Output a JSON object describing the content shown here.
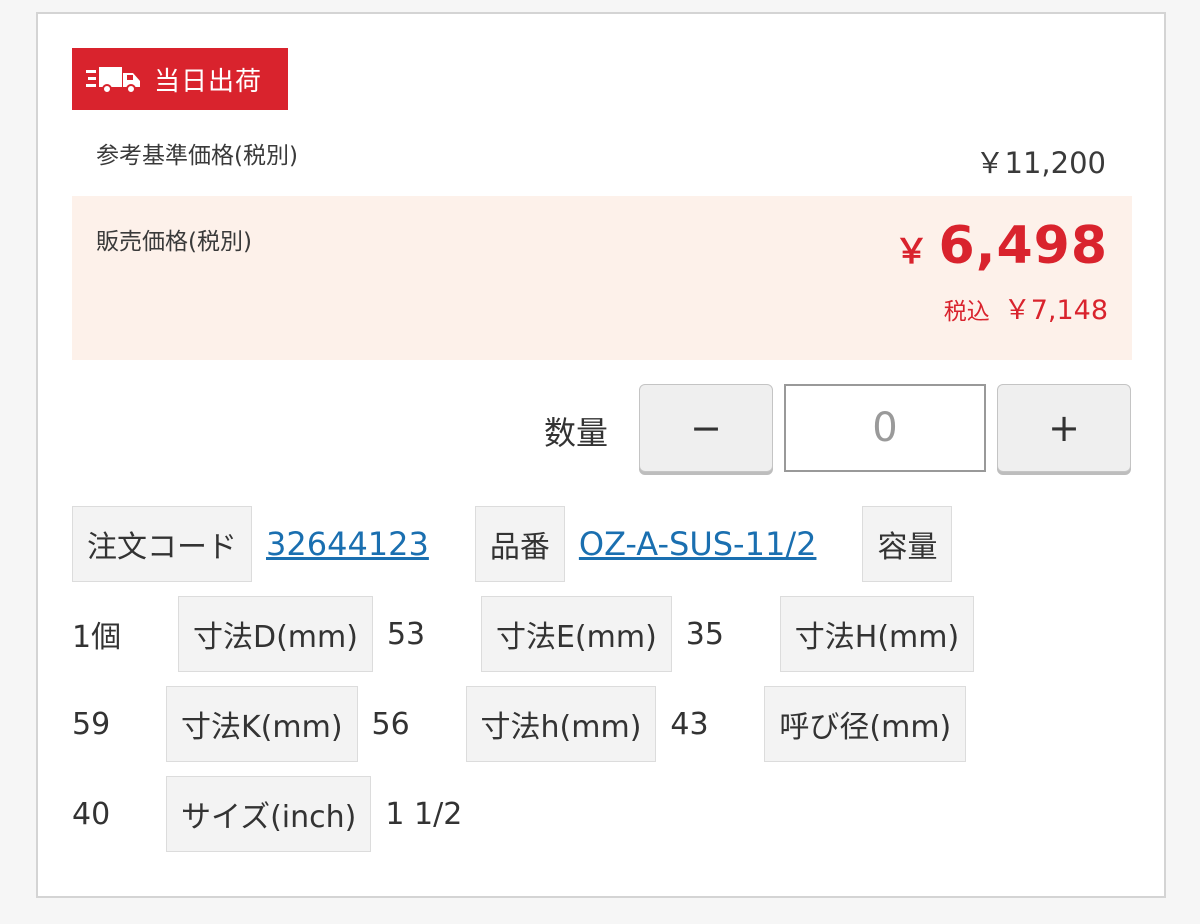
{
  "badge": {
    "label": "当日出荷",
    "icon": "truck-icon",
    "color": "#d9232d"
  },
  "reference_price": {
    "label": "参考基準価格(税別)",
    "value": "￥11,200"
  },
  "sale_price": {
    "label": "販売価格(税別)",
    "yen": "￥",
    "amount": "6,498",
    "tax_label": "税込",
    "tax_value": "￥7,148",
    "color": "#d9232d",
    "background": "#fdf1ea"
  },
  "quantity": {
    "label": "数量",
    "minus": "−",
    "value": "0",
    "plus": "+"
  },
  "specs": {
    "order_code_label": "注文コード",
    "order_code_value": "32644123",
    "part_no_label": "品番",
    "part_no_value": "OZ-A-SUS-11/2",
    "capacity_label": "容量",
    "capacity_value": "1個",
    "dim_d_label": "寸法D(mm)",
    "dim_d_value": "53",
    "dim_e_label": "寸法E(mm)",
    "dim_e_value": "35",
    "dim_h_upper_label": "寸法H(mm)",
    "dim_h_upper_value": "59",
    "dim_k_label": "寸法K(mm)",
    "dim_k_value": "56",
    "dim_h_lower_label": "寸法h(mm)",
    "dim_h_lower_value": "43",
    "nominal_label": "呼び径(mm)",
    "nominal_value": "40",
    "size_label": "サイズ(inch)",
    "size_value": "1 1/2"
  },
  "colors": {
    "link": "#1a6fb0",
    "label_bg": "#f3f3f3"
  }
}
